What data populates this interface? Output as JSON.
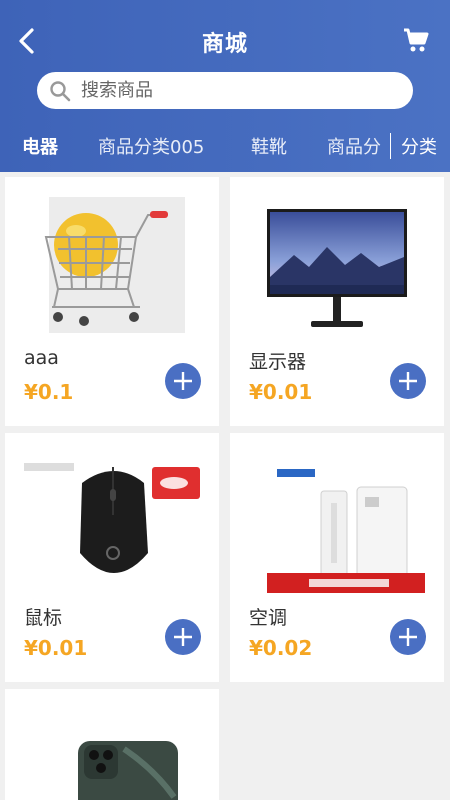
{
  "header": {
    "title": "商城",
    "back_icon": "chevron-left-icon",
    "cart_icon": "shopping-cart-icon",
    "accent": "#4a6fc3"
  },
  "search": {
    "placeholder": "搜索商品",
    "value": ""
  },
  "tabs": [
    {
      "label": "电器",
      "active": true
    },
    {
      "label": "商品分类005",
      "active": false
    },
    {
      "label": "鞋靴",
      "active": false
    },
    {
      "label": "商品分",
      "active": false
    }
  ],
  "tabs_more_label": "分类",
  "products": [
    {
      "name": "aaa",
      "price": "¥0.1",
      "image": "shopping-cart-with-grapefruit"
    },
    {
      "name": "显示器",
      "price": "¥0.01",
      "image": "monitor"
    },
    {
      "name": "鼠标",
      "price": "¥0.01",
      "image": "gaming-mouse"
    },
    {
      "name": "空调",
      "price": "¥0.02",
      "image": "air-conditioner"
    },
    {
      "name": "",
      "price": "",
      "image": "smartphone"
    }
  ],
  "colors": {
    "price": "#f5a623",
    "header_start": "#3e63b8",
    "header_end": "#4b72c4"
  }
}
